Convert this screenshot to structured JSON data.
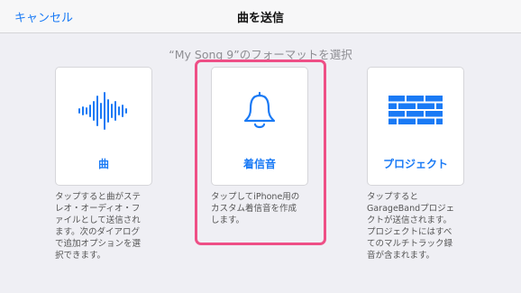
{
  "navbar": {
    "cancel_label": "キャンセル",
    "title": "曲を送信"
  },
  "subtitle": "“My Song 9”のフォーマットを選択",
  "options": [
    {
      "icon": "waveform-icon",
      "label": "曲",
      "description": "タップすると曲がステ\nレオ・オーディオ・フ\nァイルとして送信され\nます。次のダイアログ\nで追加オプションを選\n択できます。"
    },
    {
      "icon": "bell-icon",
      "label": "着信音",
      "description": "タップしてiPhone用の\nカスタム着信音を作成\nします。",
      "selected": true
    },
    {
      "icon": "bricks-icon",
      "label": "プロジェクト",
      "description": "タップすると\nGarageBandプロジェ\nクトが送信されます。\nプロジェクトにはすべ\nてのマルチトラック録\n音が含まれます。"
    }
  ],
  "colors": {
    "accent": "#1a7af5",
    "highlight": "#ee4f86",
    "background": "#efeff4"
  }
}
